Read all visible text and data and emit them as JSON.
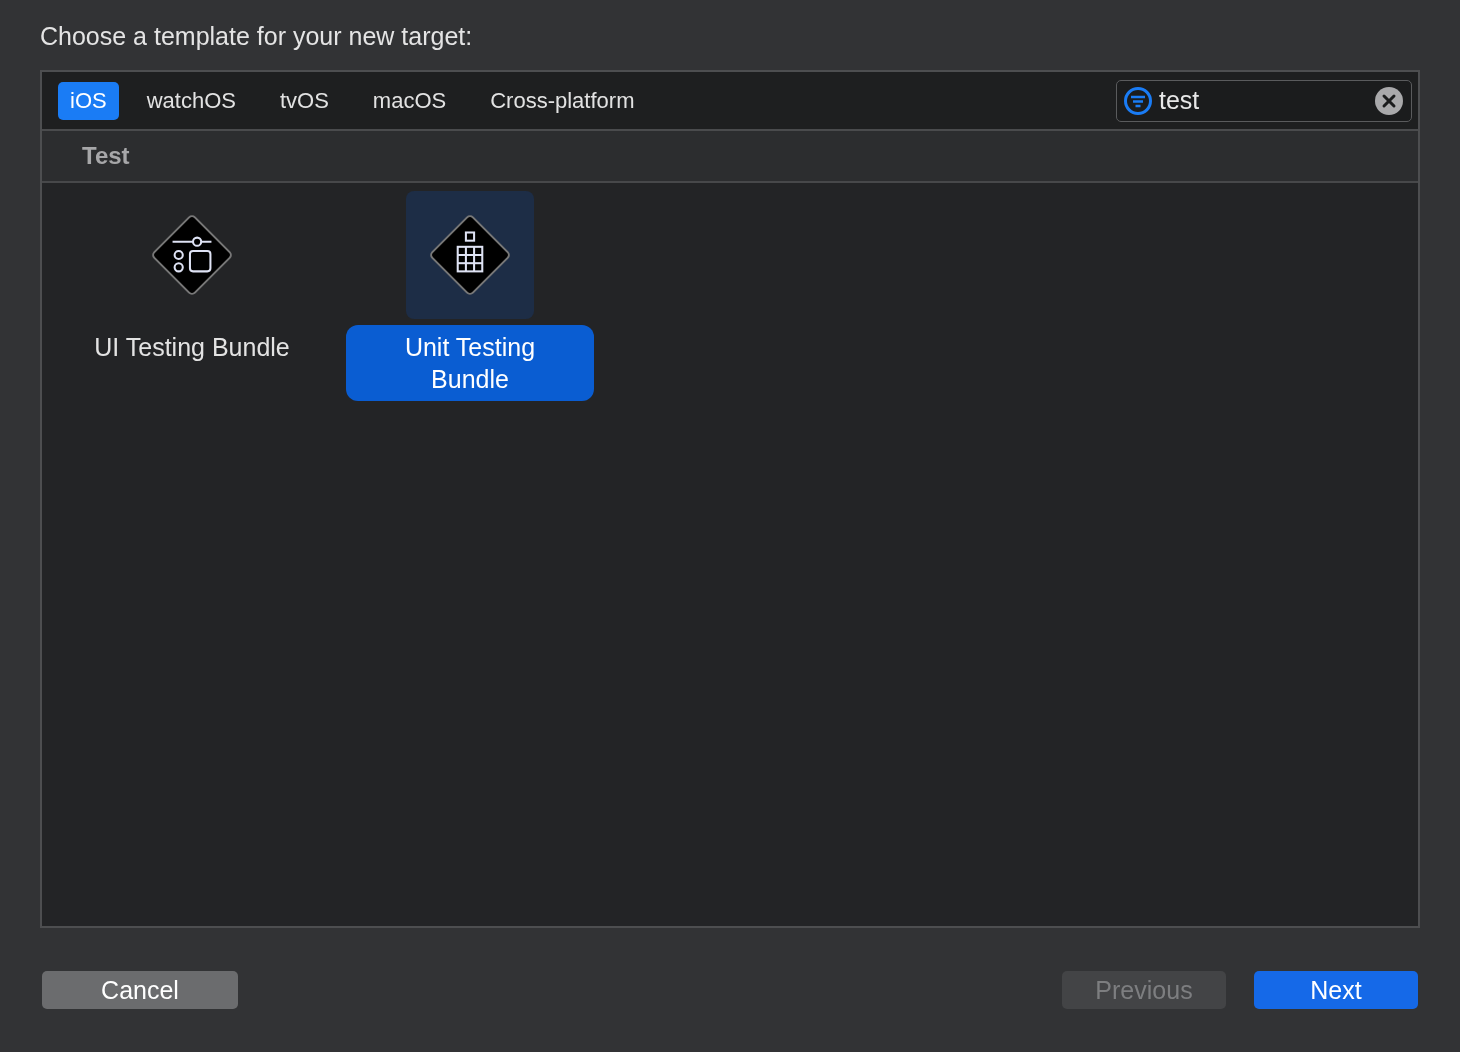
{
  "heading": "Choose a template for your new target:",
  "tabs": [
    {
      "label": "iOS",
      "selected": true
    },
    {
      "label": "watchOS",
      "selected": false
    },
    {
      "label": "tvOS",
      "selected": false
    },
    {
      "label": "macOS",
      "selected": false
    },
    {
      "label": "Cross-platform",
      "selected": false
    }
  ],
  "search": {
    "value": "test"
  },
  "section": {
    "title": "Test"
  },
  "templates": [
    {
      "kind": "ui",
      "label": "UI Testing Bundle",
      "selected": false
    },
    {
      "kind": "unit",
      "label": "Unit Testing Bundle",
      "selected": true
    }
  ],
  "buttons": [
    {
      "label": "Cancel",
      "kind": "default",
      "disabled": false
    },
    {
      "label": "Previous",
      "kind": "default",
      "disabled": true
    },
    {
      "label": "Next",
      "kind": "primary",
      "disabled": false
    }
  ]
}
